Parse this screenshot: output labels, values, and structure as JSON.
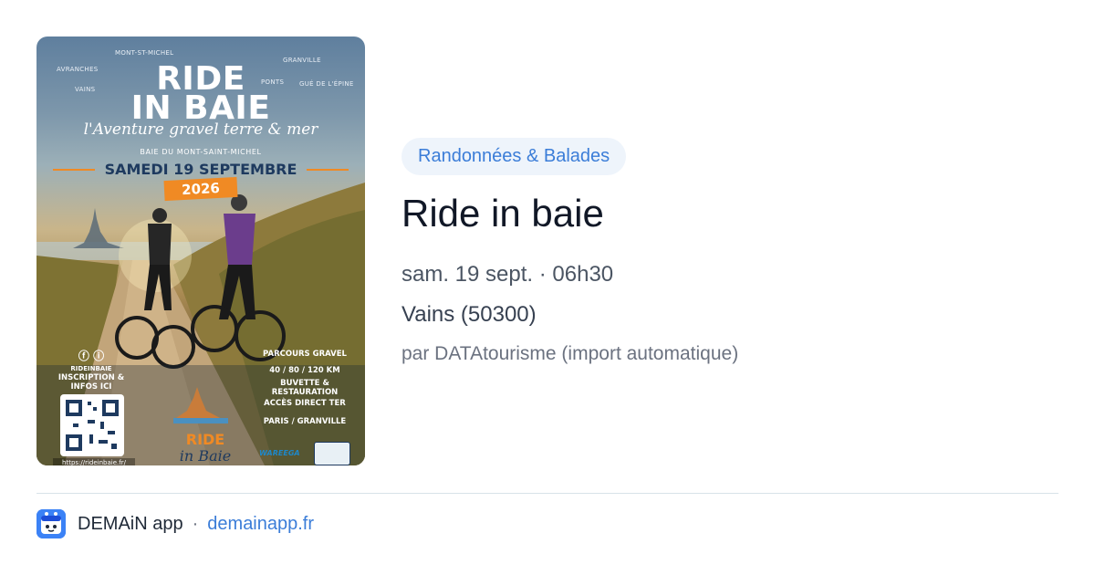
{
  "poster": {
    "places": [
      "MONT-ST-MICHEL",
      "AVRANCHES",
      "VAINS",
      "GRANVILLE",
      "PONTS",
      "GUÉ DE L'ÉPINE"
    ],
    "title_line1": "RIDE",
    "title_line2": "IN BAIE",
    "tagline": "l'Aventure gravel terre & mer",
    "location_line": "BAIE DU MONT-SAINT-MICHEL",
    "date": "SAMEDI 19 SEPTEMBRE",
    "year": "2026",
    "social": "RIDEINBAIE",
    "inscription": "INSCRIPTION & INFOS ICI",
    "url": "https://rideinbaie.fr/",
    "parcours": "PARCOURS GRAVEL",
    "distances": "40 / 80 / 120 KM",
    "buvette": "BUVETTE & RESTAURATION",
    "acces": "ACCÈS DIRECT TER",
    "acces_dest": "PARIS / GRANVILLE",
    "logo_ride": "RIDE",
    "logo_baie": "in Baie",
    "partner": "WAREEGA"
  },
  "event": {
    "category": "Randonnées & Balades",
    "title": "Ride in baie",
    "datetime": "sam. 19 sept. · 06h30",
    "location": "Vains (50300)",
    "source": "par DATAtourisme (import automatique)"
  },
  "footer": {
    "app_name": "DEMAiN app",
    "separator": "·",
    "link": "demainapp.fr"
  },
  "colors": {
    "accent": "#3b7dd8",
    "category_bg": "#eef4fb",
    "poster_orange": "#f08a24",
    "poster_navy": "#1e3a5f"
  }
}
